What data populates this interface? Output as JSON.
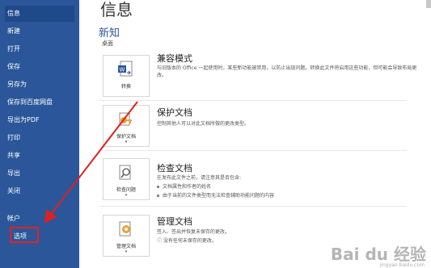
{
  "sidebar": {
    "items": [
      {
        "label": "信息"
      },
      {
        "label": "新建"
      },
      {
        "label": "打开"
      },
      {
        "label": "保存"
      },
      {
        "label": "另存为"
      },
      {
        "label": "保存到百度网盘"
      },
      {
        "label": "导出为PDF"
      },
      {
        "label": "打印"
      },
      {
        "label": "共享"
      },
      {
        "label": "导出"
      },
      {
        "label": "关闭"
      },
      {
        "label": "帐户"
      },
      {
        "label": "选项"
      }
    ]
  },
  "main": {
    "title": "信息",
    "section": "新知",
    "subsection": "桌面",
    "cards": [
      {
        "button_label": "转换",
        "title": "兼容模式",
        "desc": "与旧版本的 Office 一起使用时，某些新功能被禁用，以防止出现问题。转换此文件将启用这些功能，但可能会导致布局更改。"
      },
      {
        "button_label": "保护文档",
        "title": "保护文档",
        "desc": "控制其他人可以对此文档所做的更改类型。"
      },
      {
        "button_label": "检查问题",
        "title": "检查文档",
        "desc": "在发布此文件之前，请注意其是否包含:",
        "bullets": [
          "文档属性和作者的姓名",
          "由于当前的文件类型而无法检查辅助功能问题的内容"
        ]
      },
      {
        "button_label": "管理文档",
        "title": "管理文档",
        "desc": "签入、签出并恢复未保存的更改。",
        "note": "没有任何未保存的更改。"
      }
    ]
  },
  "watermark": {
    "text": "Bai du 经验",
    "sub": "jingyan.baidu.com"
  },
  "colors": {
    "sidebar": "#2b579a",
    "highlight": "#e02020"
  }
}
